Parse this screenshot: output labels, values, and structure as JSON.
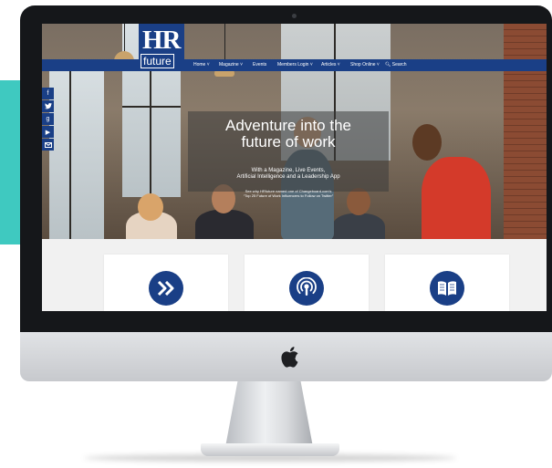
{
  "site": {
    "logo_hr": "HR",
    "logo_future": "future",
    "nav": [
      "Home ˅",
      "Magazine ˅",
      "Events",
      "Members Login ˅",
      "Articles ˅",
      "Shop Online ˅",
      "Search"
    ],
    "hero": {
      "headline_line1": "Adventure into the",
      "headline_line2": "future of work",
      "subline_1": "With a Magazine, Live Events,",
      "subline_2": "Artificial Intelligence and a Leadership App",
      "smallline_1": "See why HRfuture named one of Changeboard.com's",
      "smallline_2": "“Top 25 Future of Work Influencers to Follow on Twitter”"
    },
    "social_icons": [
      "facebook-icon",
      "twitter-icon",
      "google-plus-icon",
      "youtube-icon",
      "email-icon"
    ],
    "cards": [
      {
        "icon": "double-chevron-right-icon"
      },
      {
        "icon": "podcast-icon"
      },
      {
        "icon": "open-book-icon"
      }
    ]
  },
  "colors": {
    "brand_blue": "#1a3f86",
    "teal_accent": "#3fc9c0"
  }
}
